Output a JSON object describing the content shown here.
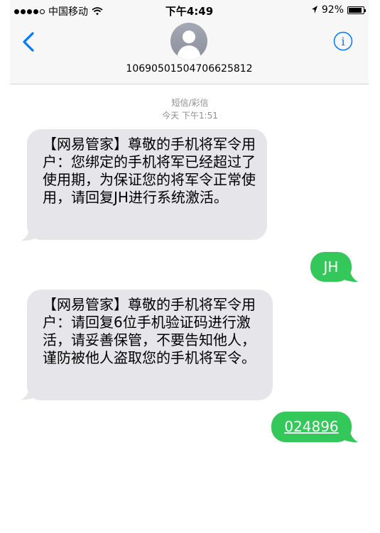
{
  "status_bar": {
    "carrier": "中国移动",
    "time": "下午4:49",
    "battery_percent": "92%",
    "battery_level": 0.92,
    "signal_bars": 4,
    "signal_total": 5
  },
  "header": {
    "contact_number": "10690501504706625812"
  },
  "meta": {
    "message_type": "短信/彩信",
    "timestamp": "今天 下午1:51"
  },
  "messages": [
    {
      "direction": "incoming",
      "text": "【网易管家】尊敬的手机将军令用户：您绑定的手机将军已经超过了使用期，为保证您的将军令正常使用，请回复JH进行系统激活。"
    },
    {
      "direction": "outgoing",
      "text": "JH"
    },
    {
      "direction": "incoming",
      "text": "【网易管家】尊敬的手机将军令用户：请回复6位手机验证码进行激活，请妥善保管，不要告知他人，谨防被他人盗取您的手机将军令。"
    },
    {
      "direction": "outgoing",
      "text": "024896"
    }
  ],
  "colors": {
    "accent": "#007aff",
    "incoming_bubble": "#e5e5ea",
    "outgoing_bubble": "#34c759",
    "meta_text": "#8e8e93"
  }
}
